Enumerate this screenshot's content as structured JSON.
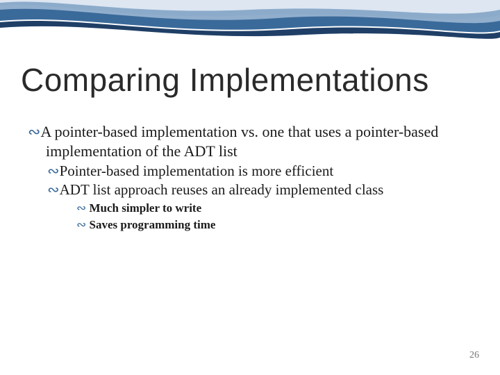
{
  "slide": {
    "title": "Comparing Implementations",
    "bullets": {
      "b1": "A pointer-based implementation vs. one that uses a pointer-based implementation of the ADT list",
      "b1_1": "Pointer-based implementation is more efficient",
      "b1_2": "ADT list approach reuses an already implemented class",
      "b1_2_1": "Much simpler to write",
      "b1_2_2": "Saves programming time"
    },
    "page_number": "26",
    "bullet_glyph": "∴"
  }
}
